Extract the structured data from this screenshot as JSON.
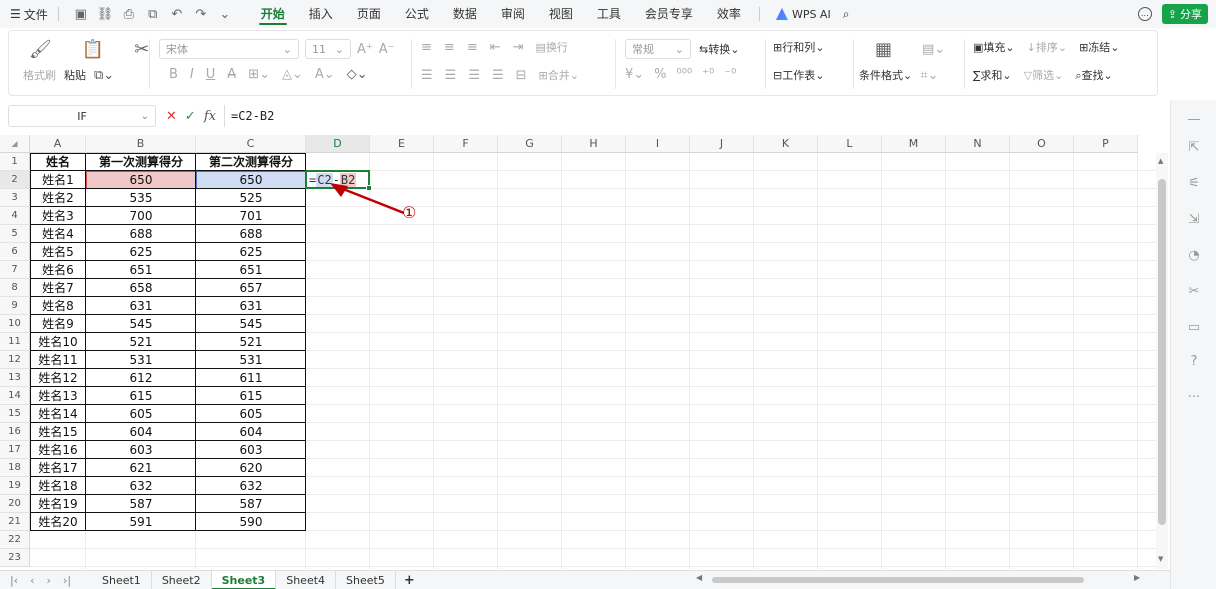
{
  "menu": {
    "file_label": "文件",
    "tabs": [
      "开始",
      "插入",
      "页面",
      "公式",
      "数据",
      "审阅",
      "视图",
      "工具",
      "会员专享",
      "效率"
    ],
    "active_tab": "开始",
    "wps_ai_label": "WPS AI",
    "share_label": "分享"
  },
  "ribbon": {
    "format_painter": "格式刷",
    "paste": "粘贴",
    "font_name": "宋体",
    "font_size": "11",
    "wrap": "换行",
    "merge": "合并",
    "number_format": "常规",
    "convert": "转换",
    "row_col": "行和列",
    "worksheet": "工作表",
    "cond_format": "条件格式",
    "fill": "填充",
    "sort": "排序",
    "freeze": "冻结",
    "sum": "求和",
    "filter": "筛选",
    "find": "查找"
  },
  "formula_bar": {
    "name_box": "IF",
    "formula": "=C2-B2"
  },
  "columns": [
    "A",
    "B",
    "C",
    "D",
    "E",
    "F",
    "G",
    "H",
    "I",
    "J",
    "K",
    "L",
    "M",
    "N",
    "O",
    "P"
  ],
  "row_numbers": [
    "1",
    "2",
    "3",
    "4",
    "5",
    "6",
    "7",
    "8",
    "9",
    "10",
    "11",
    "12",
    "13",
    "14",
    "15",
    "16",
    "17",
    "18",
    "19",
    "20",
    "21",
    "22",
    "23"
  ],
  "table": {
    "headers": [
      "姓名",
      "第一次测算得分",
      "第二次测算得分"
    ],
    "rows": [
      [
        "姓名1",
        "650",
        "650"
      ],
      [
        "姓名2",
        "535",
        "525"
      ],
      [
        "姓名3",
        "700",
        "701"
      ],
      [
        "姓名4",
        "688",
        "688"
      ],
      [
        "姓名5",
        "625",
        "625"
      ],
      [
        "姓名6",
        "651",
        "651"
      ],
      [
        "姓名7",
        "658",
        "657"
      ],
      [
        "姓名8",
        "631",
        "631"
      ],
      [
        "姓名9",
        "545",
        "545"
      ],
      [
        "姓名10",
        "521",
        "521"
      ],
      [
        "姓名11",
        "531",
        "531"
      ],
      [
        "姓名12",
        "612",
        "611"
      ],
      [
        "姓名13",
        "615",
        "615"
      ],
      [
        "姓名14",
        "605",
        "605"
      ],
      [
        "姓名15",
        "604",
        "604"
      ],
      [
        "姓名16",
        "603",
        "603"
      ],
      [
        "姓名17",
        "621",
        "620"
      ],
      [
        "姓名18",
        "632",
        "632"
      ],
      [
        "姓名19",
        "587",
        "587"
      ],
      [
        "姓名20",
        "591",
        "590"
      ]
    ]
  },
  "active_cell": {
    "address": "D2",
    "prefix": "=",
    "ref1": "C2",
    "op": "-",
    "ref2": "B2"
  },
  "annotation": {
    "label": "①",
    "color": "#c00000"
  },
  "sheets": [
    "Sheet1",
    "Sheet2",
    "Sheet3",
    "Sheet4",
    "Sheet5"
  ],
  "active_sheet": "Sheet3",
  "add_sheet_label": "+",
  "colors": {
    "accent": "#1a7f37",
    "ref_b": "#f1c8c8",
    "ref_c": "#cfdcf3"
  }
}
